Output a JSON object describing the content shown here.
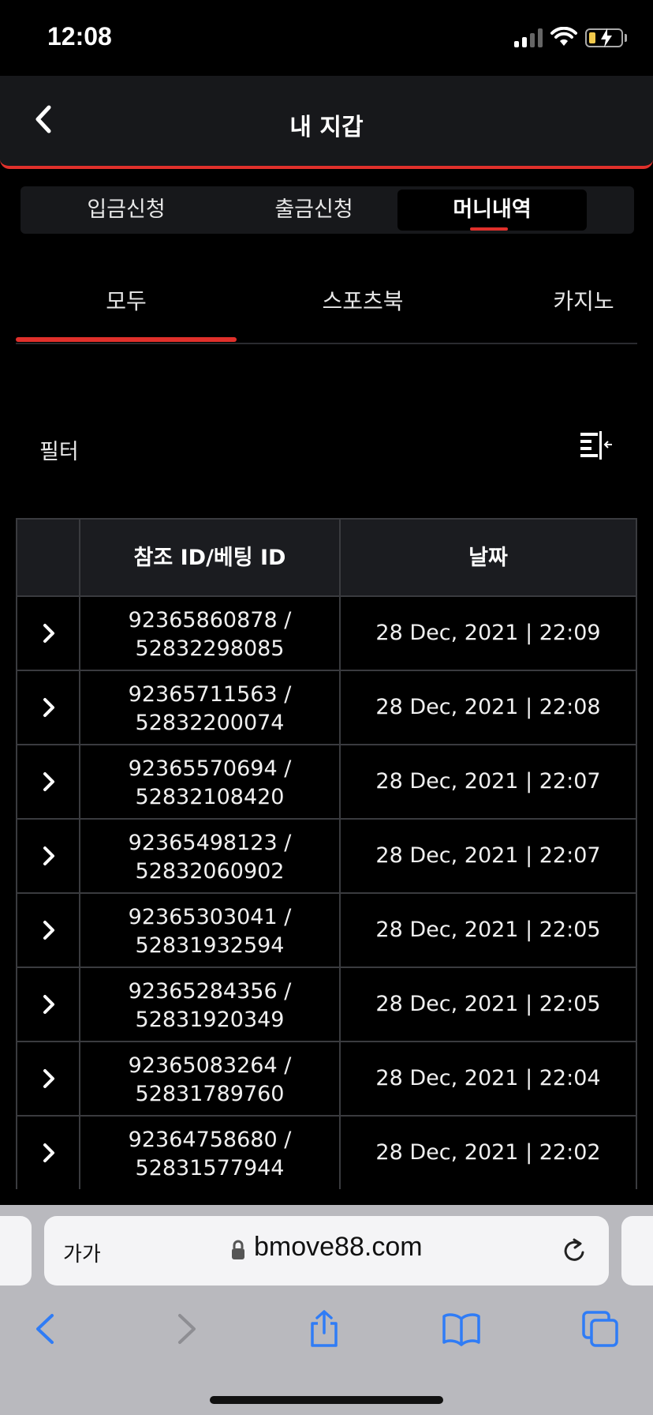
{
  "status": {
    "time": "12:08"
  },
  "header": {
    "title": "내 지갑"
  },
  "segments": [
    {
      "label": "입금신청"
    },
    {
      "label": "출금신청"
    },
    {
      "label": "머니내역"
    }
  ],
  "subtabs": [
    {
      "label": "모두"
    },
    {
      "label": "스포츠북"
    },
    {
      "label": "카지노"
    }
  ],
  "filter": {
    "label": "필터"
  },
  "table": {
    "headers": [
      "",
      "참조 ID/베팅 ID",
      "날짜"
    ],
    "rows": [
      {
        "ref": "92365860878 /",
        "bet": "52832298085",
        "date": "28 Dec, 2021 | 22:09"
      },
      {
        "ref": "92365711563 /",
        "bet": "52832200074",
        "date": "28 Dec, 2021 | 22:08"
      },
      {
        "ref": "92365570694 /",
        "bet": "52832108420",
        "date": "28 Dec, 2021 | 22:07"
      },
      {
        "ref": "92365498123 /",
        "bet": "52832060902",
        "date": "28 Dec, 2021 | 22:07"
      },
      {
        "ref": "92365303041 /",
        "bet": "52831932594",
        "date": "28 Dec, 2021 | 22:05"
      },
      {
        "ref": "92365284356 /",
        "bet": "52831920349",
        "date": "28 Dec, 2021 | 22:05"
      },
      {
        "ref": "92365083264 /",
        "bet": "52831789760",
        "date": "28 Dec, 2021 | 22:04"
      },
      {
        "ref": "92364758680 /",
        "bet": "52831577944",
        "date": "28 Dec, 2021 | 22:02"
      }
    ]
  },
  "browser": {
    "text_size": "가가",
    "url": "bmove88.com"
  },
  "colors": {
    "accent": "#e0302b",
    "header_bg": "#17181b",
    "browser_blue": "#2f7cf6"
  }
}
